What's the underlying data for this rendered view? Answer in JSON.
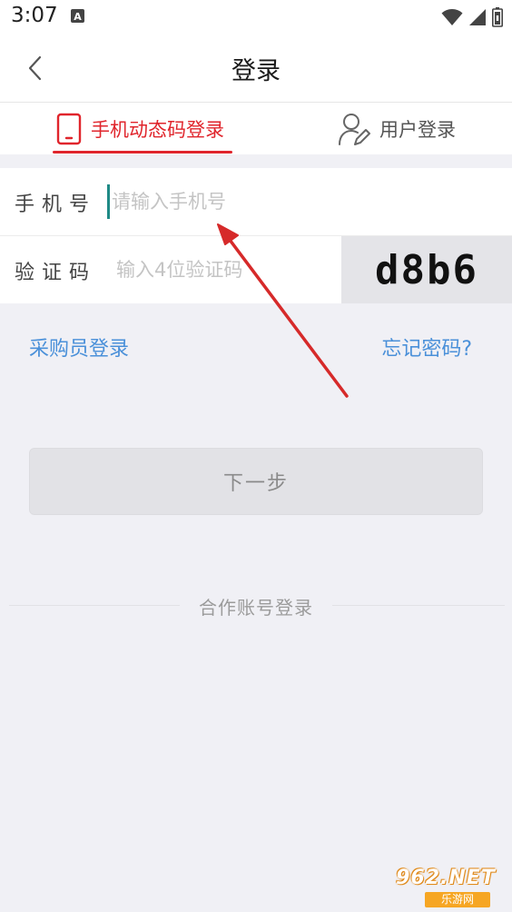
{
  "status_bar": {
    "time": "3:07",
    "icons": [
      "a-notification-icon",
      "wifi-icon",
      "signal-icon",
      "battery-icon"
    ]
  },
  "header": {
    "title": "登录",
    "back_icon": "chevron-left-icon"
  },
  "tabs": [
    {
      "label": "手机动态码登录",
      "icon": "phone-icon",
      "active": true
    },
    {
      "label": "用户登录",
      "icon": "user-edit-icon",
      "active": false
    }
  ],
  "form": {
    "phone_label": "手机号",
    "phone_placeholder": "请输入手机号",
    "phone_value": "",
    "code_label": "验证码",
    "code_placeholder": "输入4位验证码",
    "code_value": "",
    "captcha_text": "d8b6"
  },
  "links": {
    "buyer_login": "采购员登录",
    "forgot_password": "忘记密码?"
  },
  "next_button": "下一步",
  "partner_login": "合作账号登录",
  "watermark": {
    "top": "962.NET",
    "bottom": "乐游网"
  },
  "colors": {
    "accent": "#e0252c",
    "link": "#4a90d9",
    "background": "#f0f0f5",
    "cursor": "#1f8a86",
    "annotation_arrow": "#d62a2a"
  }
}
